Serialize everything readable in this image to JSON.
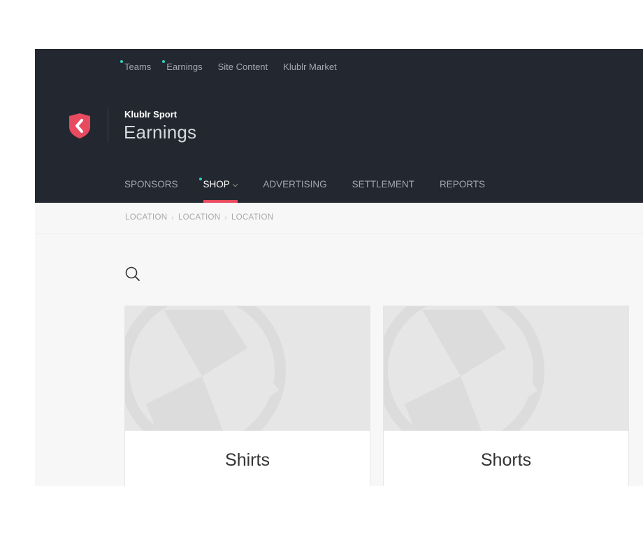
{
  "topnav": {
    "items": [
      {
        "label": "Teams",
        "dot": true
      },
      {
        "label": "Earnings",
        "dot": true
      },
      {
        "label": "Site Content",
        "dot": false
      },
      {
        "label": "Klublr Market",
        "dot": false
      }
    ]
  },
  "header": {
    "org_name": "Klublr Sport",
    "page_title": "Earnings"
  },
  "tabs": [
    {
      "label": "SPONSORS",
      "active": false
    },
    {
      "label": "SHOP",
      "active": true
    },
    {
      "label": "ADVERTISING",
      "active": false
    },
    {
      "label": "SETTLEMENT",
      "active": false
    },
    {
      "label": "REPORTS",
      "active": false
    }
  ],
  "breadcrumb": [
    "LOCATION",
    "LOCATION",
    "LOCATION"
  ],
  "cards": [
    {
      "label": "Shirts"
    },
    {
      "label": "Shorts"
    }
  ],
  "colors": {
    "header_bg": "#232830",
    "accent": "#e84a5f",
    "dot": "#2dd4bf"
  }
}
